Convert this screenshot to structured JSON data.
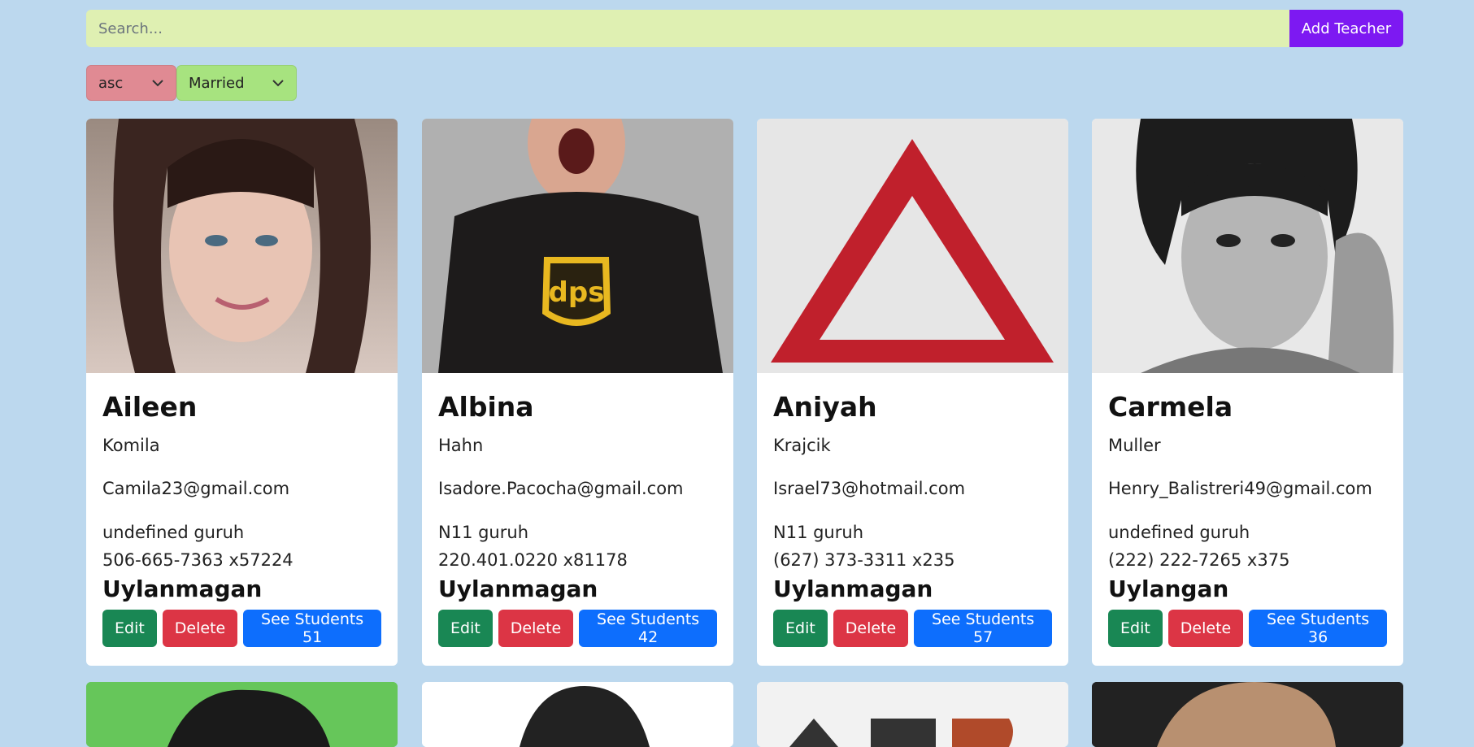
{
  "search": {
    "placeholder": "Search...",
    "value": ""
  },
  "add_teacher_label": "Add Teacher",
  "filters": {
    "sort": "asc",
    "status": "Married"
  },
  "colors": {
    "background": "#bcd8ee",
    "search_bg": "#dff0b2",
    "add_btn": "#7d19f2",
    "edit": "#198754",
    "delete": "#dc3545",
    "students": "#0d6efd"
  },
  "teachers": [
    {
      "first_name": "Aileen",
      "last_name": "Komila",
      "email": "Camila23@gmail.com",
      "group": "undefined guruh",
      "phone": "506-665-7363 x57224",
      "marital_status": "Uylanmagan",
      "edit_label": "Edit",
      "delete_label": "Delete",
      "students_label": "See Students 51"
    },
    {
      "first_name": "Albina",
      "last_name": "Hahn",
      "email": "Isadore.Pacocha@gmail.com",
      "group": "N11 guruh",
      "phone": "220.401.0220 x81178",
      "marital_status": "Uylanmagan",
      "edit_label": "Edit",
      "delete_label": "Delete",
      "students_label": "See Students 42"
    },
    {
      "first_name": "Aniyah",
      "last_name": "Krajcik",
      "email": "Israel73@hotmail.com",
      "group": "N11 guruh",
      "phone": "(627) 373-3311 x235",
      "marital_status": "Uylanmagan",
      "edit_label": "Edit",
      "delete_label": "Delete",
      "students_label": "See Students 57"
    },
    {
      "first_name": "Carmela",
      "last_name": "Muller",
      "email": "Henry_Balistreri49@gmail.com",
      "group": "undefined guruh",
      "phone": "(222) 222-7265 x375",
      "marital_status": "Uylangan",
      "edit_label": "Edit",
      "delete_label": "Delete",
      "students_label": "See Students 36"
    }
  ],
  "photo_icons": [
    "woman-portrait",
    "man-dps-shirt",
    "warning-triangle",
    "man-portrait-bw",
    "green-avatar",
    "man-portrait",
    "logo-letters",
    "man-portrait-long-hair"
  ]
}
